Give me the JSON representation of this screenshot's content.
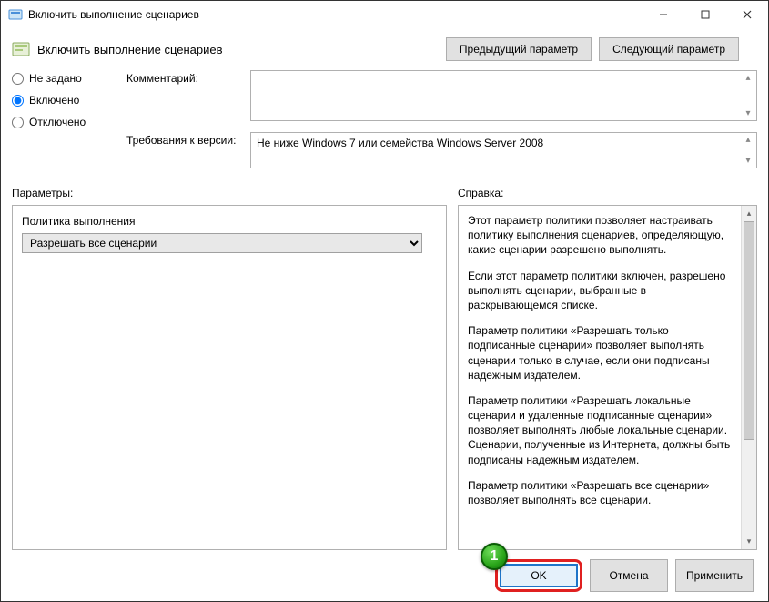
{
  "window": {
    "title": "Включить выполнение сценариев"
  },
  "header": {
    "title": "Включить выполнение сценариев",
    "prev": "Предыдущий параметр",
    "next": "Следующий параметр"
  },
  "radios": {
    "not_configured": "Не задано",
    "enabled": "Включено",
    "disabled": "Отключено",
    "selected": "enabled"
  },
  "labels": {
    "comment": "Комментарий:",
    "requirements": "Требования к версии:",
    "options": "Параметры:",
    "help": "Справка:"
  },
  "fields": {
    "comment": "",
    "requirements": "Не ниже Windows 7 или семейства Windows Server 2008"
  },
  "options": {
    "policy_label": "Политика выполнения",
    "policy_value": "Разрешать все сценарии"
  },
  "help": {
    "p1": "Этот параметр политики позволяет настраивать политику выполнения сценариев, определяющую, какие сценарии разрешено выполнять.",
    "p2": "Если этот параметр политики включен, разрешено выполнять сценарии, выбранные в раскрывающемся списке.",
    "p3": "Параметр политики «Разрешать только подписанные сценарии» позволяет выполнять сценарии только в случае, если они подписаны надежным издателем.",
    "p4": "Параметр политики «Разрешать локальные сценарии и удаленные подписанные сценарии» позволяет выполнять любые локальные сценарии. Сценарии, полученные из Интернета, должны быть подписаны надежным издателем.",
    "p5": "Параметр политики «Разрешать все сценарии» позволяет выполнять все сценарии."
  },
  "footer": {
    "ok": "OK",
    "cancel": "Отмена",
    "apply": "Применить"
  },
  "marker": "1"
}
